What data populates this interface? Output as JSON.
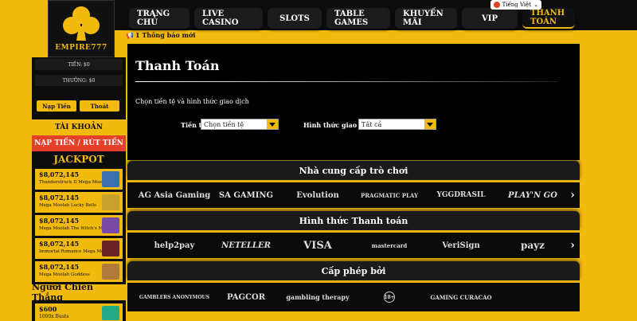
{
  "header": {
    "logo": {
      "brand": "EMPIRE",
      "suffix": "777"
    },
    "nav": [
      {
        "label": "TRANG CHỦ",
        "w": 0
      },
      {
        "label": "LIVE CASINO"
      },
      {
        "label": "SLOTS"
      },
      {
        "label": "TABLE GAMES"
      },
      {
        "label": "KHUYẾN MÃI"
      },
      {
        "label": "VIP"
      },
      {
        "label": "THANH TOÁN"
      }
    ],
    "language": "Tiếng Việt",
    "notice": "1 Thông báo mới"
  },
  "sidebar": {
    "balance_label": "TIỀN: $0",
    "bonus_label": "THƯỞNG: $0",
    "deposit_button": "Nạp Tiền",
    "logout_button": "Thoát",
    "account_menu": "TÀI KHOẢN",
    "deposit_withdraw_menu": "NẠP TIỀN / RÚT TIỀN",
    "jackpot_title": "JACKPOT",
    "jackpots": [
      {
        "amount": "$8,072,145",
        "game": "Thunderstruck II Mega Moolah",
        "color": "#3a6fb0"
      },
      {
        "amount": "$8,072,145",
        "game": "Mega Moolah Lucky Bells",
        "color": "#c9a12a"
      },
      {
        "amount": "$8,072,145",
        "game": "Mega Moolah The Witch's Moon",
        "color": "#7a4aa8"
      },
      {
        "amount": "$8,072,145",
        "game": "Immortal Romance Mega Moolah",
        "color": "#6a2222"
      },
      {
        "amount": "$8,072,145",
        "game": "Mega Moolah Goddess",
        "color": "#b07a3a"
      }
    ],
    "winners_title": "Người Chiến Thắng",
    "winners": [
      {
        "amount": "$600",
        "game": "1000x Busts"
      }
    ]
  },
  "main": {
    "title": "Thanh Toán",
    "instruction": "Chọn tiền tệ và hình thức giao dịch",
    "currency_label": "Tiền tệ",
    "currency_value": "Chọn tiền tệ",
    "method_label": "Hình thức giao dịch",
    "method_value": "Tất cả"
  },
  "providers": {
    "title": "Nhà cung cấp trò chơi",
    "items": [
      "AG Asia Gaming",
      "SA GAMING",
      "Evolution",
      "PRAGMATIC PLAY",
      "YGGDRASIL",
      "PLAY'N GO"
    ]
  },
  "payments": {
    "title": "Hình thức Thanh toán",
    "items": [
      "help2pay",
      "NETELLER",
      "VISA",
      "mastercard",
      "VeriSign",
      "payz"
    ]
  },
  "licenses": {
    "title": "Cấp phép bởi",
    "items": [
      "GAMBLERS ANONYMOUS",
      "PAGCOR",
      "gambling therapy",
      "18+",
      "GAMING CURACAO"
    ]
  }
}
